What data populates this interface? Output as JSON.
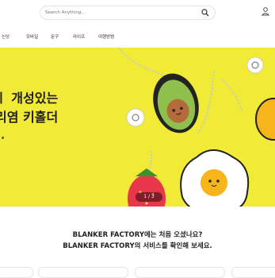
{
  "search": {
    "placeholder": "Search Anything..."
  },
  "nav": {
    "items": [
      "신상",
      "모바일",
      "문구",
      "라이프",
      "여행방범"
    ]
  },
  "banner": {
    "headline_line1": "ㅣ 개성있는",
    "headline_line2": "리염 키홀더",
    "slide_counter": "1 / 3"
  },
  "welcome": {
    "line1": "BLANKER FACTORY에는 처음 오셨나요?",
    "line2": "BLANKER FACTORY의 서비스를 확인해 보세요."
  },
  "colors": {
    "banner_bg": "#f1ea36",
    "avocado": "#7fb244",
    "egg_yolk": "#f6b51a"
  },
  "icons": [
    "search-icon",
    "user-icon"
  ]
}
